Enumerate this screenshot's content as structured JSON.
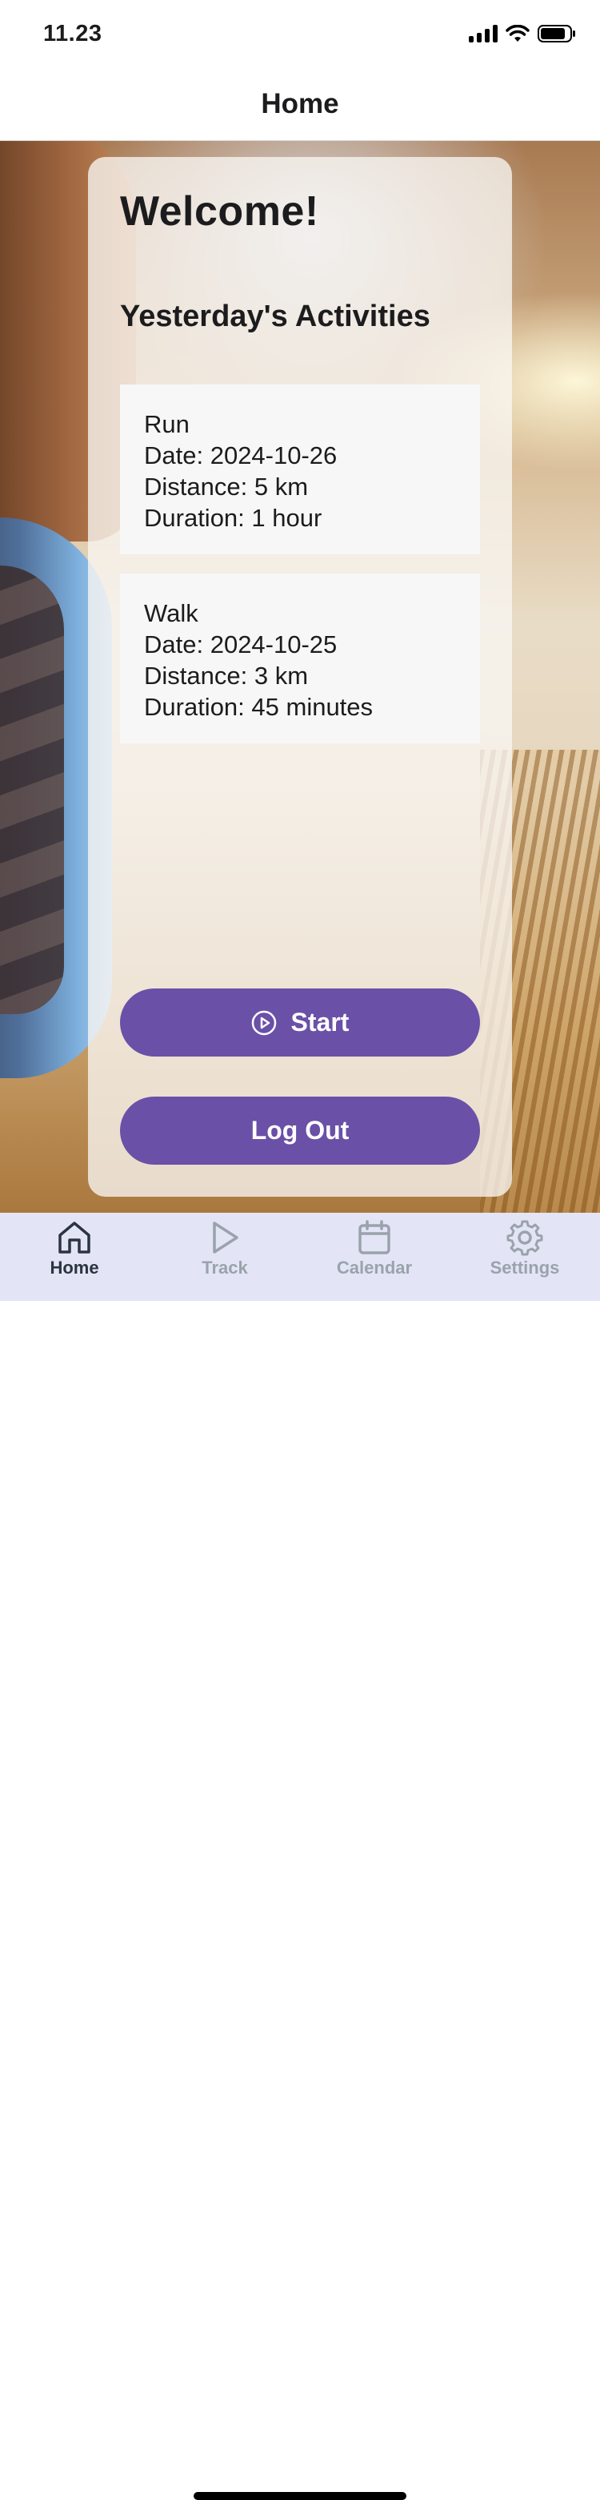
{
  "status_bar": {
    "time": "11.23"
  },
  "header": {
    "title": "Home"
  },
  "card": {
    "welcome": "Welcome!",
    "section_title": "Yesterday's Activities",
    "activities": [
      {
        "type": "Run",
        "date": "Date: 2024-10-26",
        "distance": "Distance: 5 km",
        "duration": "Duration: 1 hour"
      },
      {
        "type": "Walk",
        "date": "Date: 2024-10-25",
        "distance": "Distance: 3 km",
        "duration": "Duration: 45 minutes"
      }
    ],
    "start_label": "Start",
    "logout_label": "Log Out"
  },
  "tabs": [
    {
      "label": "Home",
      "icon": "home-icon",
      "active": true
    },
    {
      "label": "Track",
      "icon": "play-icon",
      "active": false
    },
    {
      "label": "Calendar",
      "icon": "calendar-icon",
      "active": false
    },
    {
      "label": "Settings",
      "icon": "gear-icon",
      "active": false
    }
  ],
  "colors": {
    "primary_button": "#6a50a7",
    "tab_bar_bg": "#e3e5f7",
    "tab_active": "#2c3440",
    "tab_inactive": "#9aa3ab"
  }
}
